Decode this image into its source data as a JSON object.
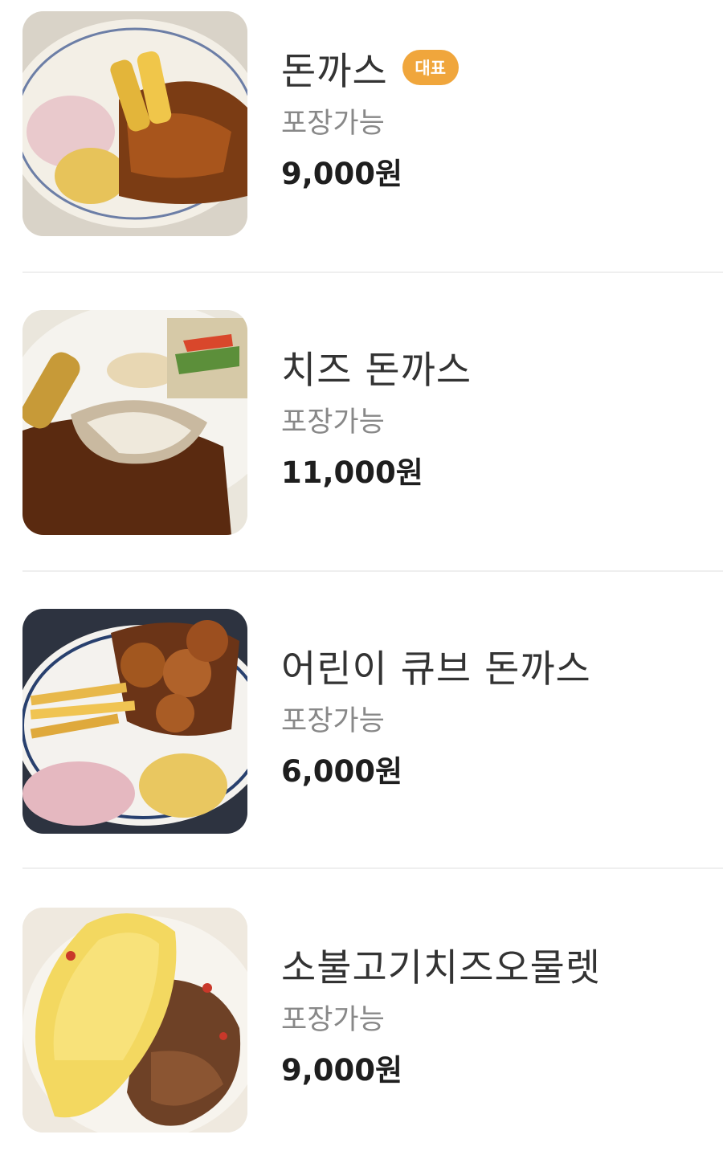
{
  "menu": {
    "items": [
      {
        "name": "돈까스",
        "badge": "대표",
        "takeout": "포장가능",
        "price": "9,000원"
      },
      {
        "name": "치즈 돈까스",
        "badge": "",
        "takeout": "포장가능",
        "price": "11,000원"
      },
      {
        "name": "어린이 큐브 돈까스",
        "badge": "",
        "takeout": "포장가능",
        "price": "6,000원"
      },
      {
        "name": "소불고기치즈오물렛",
        "badge": "",
        "takeout": "포장가능",
        "price": "9,000원"
      }
    ]
  },
  "colors": {
    "badge": "#f0a63c",
    "name_text": "#333333",
    "sub_text": "#888888",
    "price_text": "#1e1e1e",
    "divider": "#efefef"
  }
}
